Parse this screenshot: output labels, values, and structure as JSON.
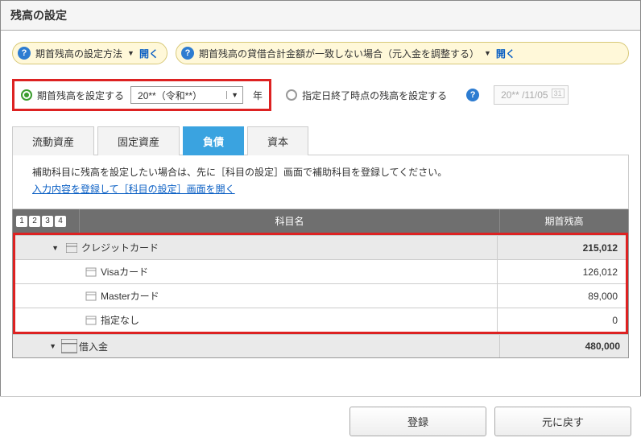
{
  "title": "残高の設定",
  "help": {
    "pill1": "期首残高の設定方法",
    "pill2": "期首残高の貸借合計金額が一致しない場合（元入金を調整する）",
    "open": "開く"
  },
  "radio": {
    "opt1": "期首残高を設定する",
    "era": "20**（令和**）",
    "year": "年",
    "opt2": "指定日終了時点の残高を設定する",
    "date_placeholder": "20** /11/05"
  },
  "tabs": {
    "t1": "流動資産",
    "t2": "固定資産",
    "t3": "負債",
    "t4": "資本"
  },
  "note": {
    "text": "補助科目に残高を設定したい場合は、先に［科目の設定］画面で補助科目を登録してください。",
    "link": "入力内容を登録して［科目の設定］画面を開く"
  },
  "gridhead": {
    "name": "科目名",
    "balance": "期首残高"
  },
  "rows": {
    "credit_card": {
      "name": "クレジットカード",
      "balance": "215,012"
    },
    "visa": {
      "name": "Visaカード",
      "balance": "126,012"
    },
    "master": {
      "name": "Masterカード",
      "balance": "89,000"
    },
    "none": {
      "name": "指定なし",
      "balance": "0"
    },
    "loan": {
      "name": "借入金",
      "balance": "480,000"
    }
  },
  "buttons": {
    "register": "登録",
    "revert": "元に戻す"
  }
}
